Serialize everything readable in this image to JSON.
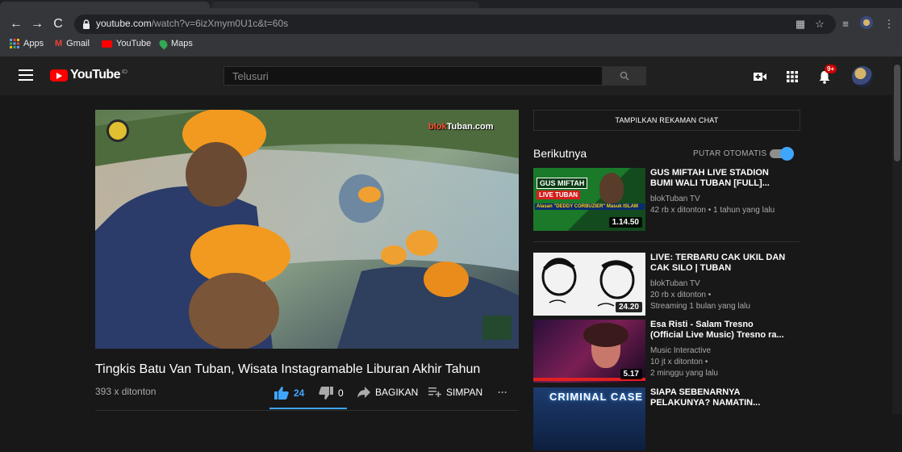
{
  "browser": {
    "url_host": "youtube.com",
    "url_path": "/watch?v=6izXmym0U1c&t=60s",
    "bookmarks": [
      "Apps",
      "Gmail",
      "YouTube",
      "Maps"
    ]
  },
  "header": {
    "logo_text": "YouTube",
    "logo_superscript": "ID",
    "search_placeholder": "Telusuri",
    "notification_count": "9+"
  },
  "video": {
    "watermark_brand": "blok",
    "watermark_tail": "Tuban.com",
    "title": "Tingkis Batu Van Tuban, Wisata Instagramable Liburan Akhir Tahun",
    "views": "393 x ditonton",
    "like_count": "24",
    "dislike_count": "0",
    "share_label": "BAGIKAN",
    "save_label": "SIMPAN",
    "more_label": "···"
  },
  "sidebar": {
    "chat_button": "TAMPILKAN REKAMAN CHAT",
    "next_label": "Berikutnya",
    "autoplay_label": "PUTAR OTOMATIS",
    "autoplay_on": true,
    "items": [
      {
        "title": "GUS MIFTAH LIVE STADION BUMI WALI TUBAN [FULL]...",
        "channel": "blokTuban TV",
        "meta1": "42 rb x ditonton • 1 tahun yang lalu",
        "meta2": "",
        "duration": "1.14.50",
        "thumb_text1": "GUS MIFTAH",
        "thumb_text2": "LIVE TUBAN",
        "thumb_text3": "Alasan \"DEDDY CORBUZIER\" Masuk ISLAM"
      },
      {
        "title": "LIVE: TERBARU CAK UKIL DAN CAK SILO | TUBAN",
        "channel": "blokTuban TV",
        "meta1": "20 rb x ditonton •",
        "meta2": "Streaming 1 bulan yang lalu",
        "duration": "24.20"
      },
      {
        "title": "Esa Risti - Salam Tresno (Official Live Music) Tresno ra...",
        "channel": "Music Interactive",
        "meta1": "10 jt x ditonton •",
        "meta2": "2 minggu yang lalu",
        "duration": "5.17"
      },
      {
        "title": "SIAPA SEBENARNYA PELAKUNYA? NAMATIN...",
        "channel": "",
        "meta1": "",
        "meta2": "",
        "duration": "",
        "thumb_text1": "CRIMINAL CASE"
      }
    ]
  }
}
